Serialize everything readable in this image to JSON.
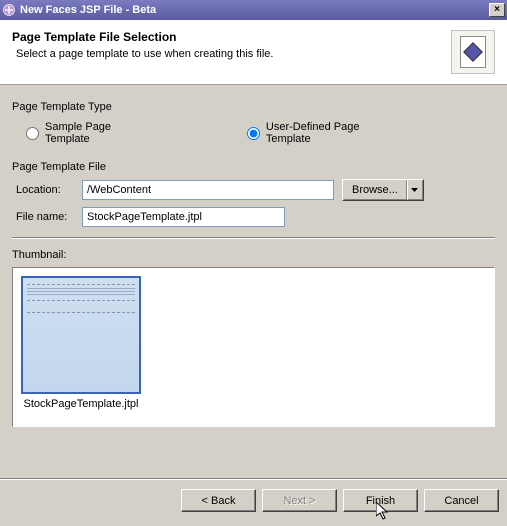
{
  "window": {
    "title": "New Faces JSP File - Beta"
  },
  "header": {
    "title": "Page Template File Selection",
    "subtitle": "Select a page template to use when creating this file."
  },
  "template_type": {
    "group_label": "Page Template Type",
    "sample_label": "Sample Page Template",
    "user_label": "User-Defined Page Template",
    "selected": "user"
  },
  "template_file": {
    "group_label": "Page Template File",
    "location_label": "Location:",
    "location_value": "/WebContent",
    "filename_label": "File name:",
    "filename_value": "StockPageTemplate.jtpl",
    "browse_label": "Browse..."
  },
  "thumbnail": {
    "label": "Thumbnail:",
    "item_caption": "StockPageTemplate.jtpl"
  },
  "buttons": {
    "back": "< Back",
    "next": "Next >",
    "finish": "Finish",
    "cancel": "Cancel"
  }
}
